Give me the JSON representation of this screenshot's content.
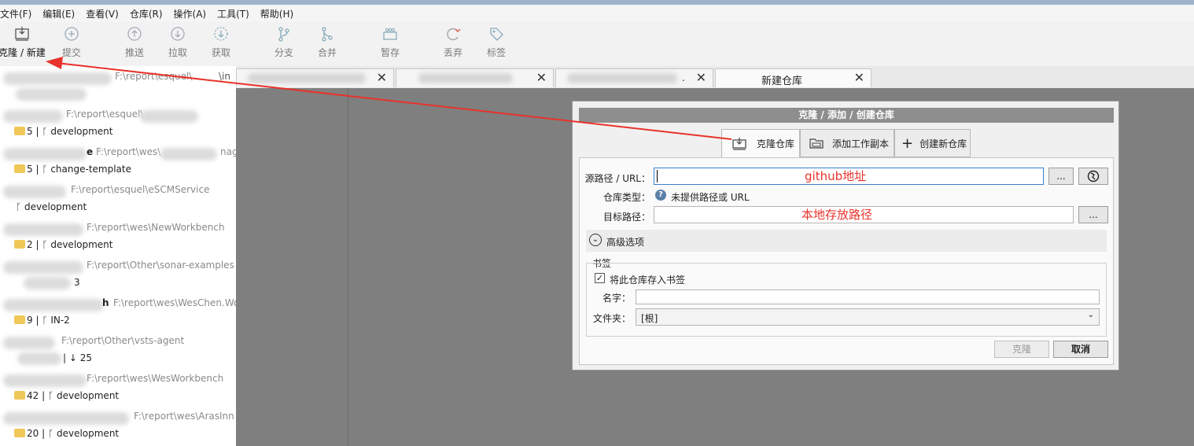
{
  "menu": [
    "文件(F)",
    "编辑(E)",
    "查看(V)",
    "仓库(R)",
    "操作(A)",
    "工具(T)",
    "帮助(H)"
  ],
  "toolbar": {
    "clone": "克隆 / 新建",
    "commit": "提交",
    "push": "推送",
    "pull": "拉取",
    "fetch": "获取",
    "branch": "分支",
    "merge": "合并",
    "stash": "暂存",
    "discard": "丢弃",
    "tag": "标签"
  },
  "sidebar": {
    "repos": [
      {
        "path": "F:\\report\\esquel\\",
        "sub": "",
        "branch": "",
        "path2": "\\in"
      },
      {
        "path": "F:\\report\\esquel\\",
        "sub": "5",
        "branch": "development"
      },
      {
        "path": "F:\\report\\wes\\",
        "sub": "5",
        "branch": "change-template",
        "name_suffix": "e",
        "path2": "nag"
      },
      {
        "path": "F:\\report\\esquel\\eSCMService",
        "sub": "",
        "branch": "development"
      },
      {
        "path": "F:\\report\\wes\\NewWorkbench",
        "sub": "2",
        "branch": "development"
      },
      {
        "path": "F:\\report\\Other\\sonar-examples",
        "sub": "",
        "branch": "3"
      },
      {
        "path": "F:\\report\\wes\\WesChen.Wo",
        "sub": "9",
        "branch": "IN-2",
        "name_suffix": "h"
      },
      {
        "path": "F:\\report\\Other\\vsts-agent",
        "sub": "",
        "branch": "↓ 25"
      },
      {
        "path": "F:\\report\\wes\\WesWorkbench",
        "sub": "42",
        "branch": "development"
      },
      {
        "path": "F:\\report\\wes\\ArasInn",
        "sub": "20",
        "branch": "development"
      }
    ]
  },
  "tabs": {
    "active_label": "新建仓库",
    "fourth_suffix": "."
  },
  "dialog": {
    "title": "克隆 / 添加 / 创建仓库",
    "tab_clone": "克隆仓库",
    "tab_add": "添加工作副本",
    "tab_create": "创建新仓库",
    "source_label": "源路径 / URL：",
    "source_value": "",
    "source_annot": "github地址",
    "repo_type_label": "仓库类型：",
    "repo_type_value": "未提供路径或 URL",
    "target_label": "目标路径：",
    "target_value": "",
    "target_annot": "本地存放路径",
    "browse": "...",
    "advanced": "高级选项",
    "bookmark_group": "书签",
    "bookmark_check": "将此仓库存入书签",
    "name_label": "名字：",
    "name_value": "",
    "folder_label": "文件夹：",
    "folder_value": "[根]",
    "clone_btn": "克隆",
    "cancel_btn": "取消"
  },
  "colors": {
    "annotation_red": "#e8322b",
    "main_bg": "#7f7f7f",
    "dialog_title_bg": "#8e8e8e"
  }
}
